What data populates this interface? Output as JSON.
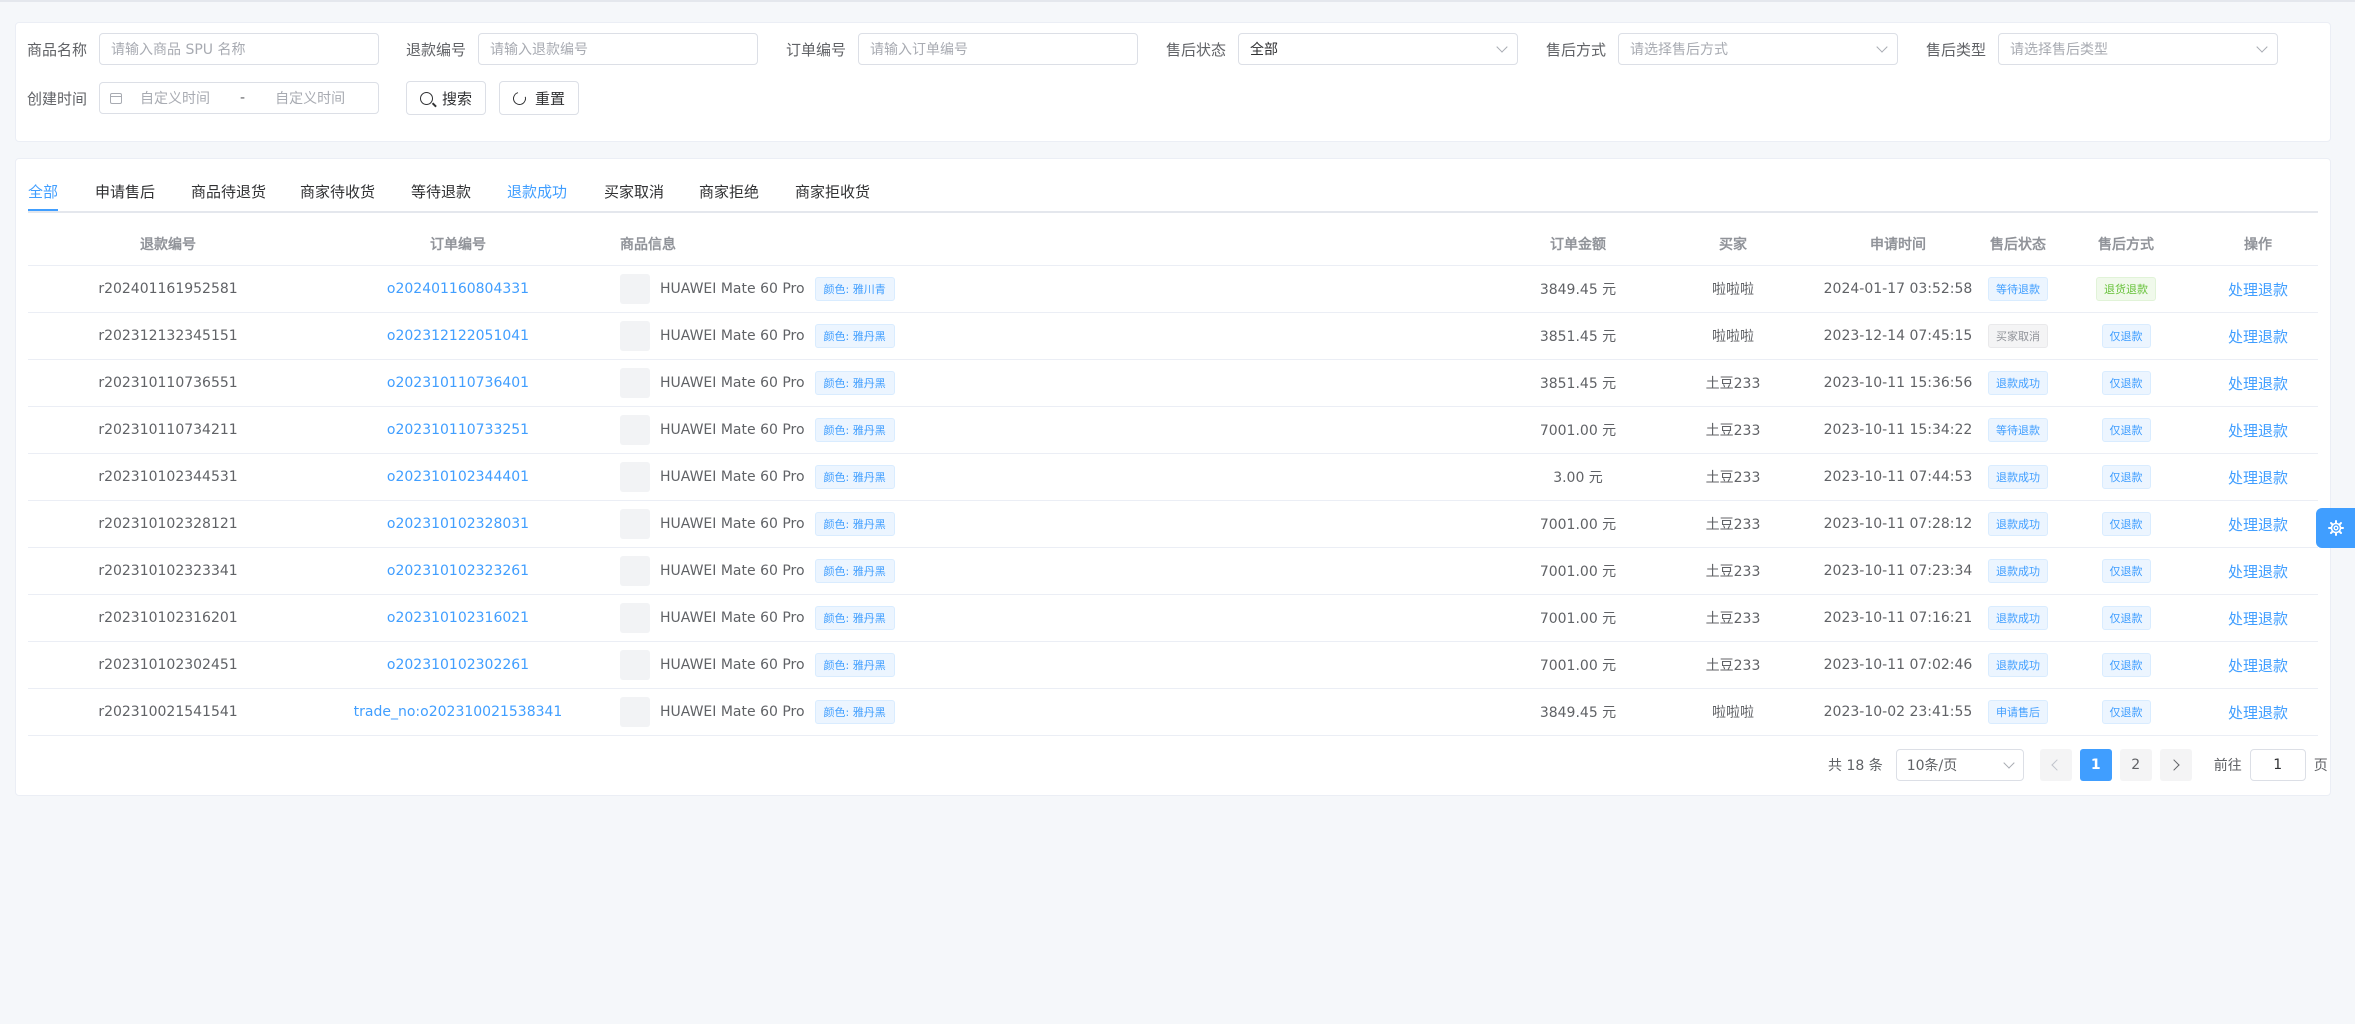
{
  "filters": {
    "product_name": {
      "label": "商品名称",
      "placeholder": "请输入商品 SPU 名称"
    },
    "refund_no": {
      "label": "退款编号",
      "placeholder": "请输入退款编号"
    },
    "order_no": {
      "label": "订单编号",
      "placeholder": "请输入订单编号"
    },
    "aftersale_status": {
      "label": "售后状态",
      "value": "全部"
    },
    "aftersale_way": {
      "label": "售后方式",
      "placeholder": "请选择售后方式"
    },
    "aftersale_type": {
      "label": "售后类型",
      "placeholder": "请选择售后类型"
    },
    "create_time": {
      "label": "创建时间",
      "start_placeholder": "自定义时间",
      "separator": "-",
      "end_placeholder": "自定义时间"
    },
    "search_label": "搜索",
    "reset_label": "重置"
  },
  "tabs": [
    "全部",
    "申请售后",
    "商品待退货",
    "商家待收货",
    "等待退款",
    "退款成功",
    "买家取消",
    "商家拒绝",
    "商家拒收货"
  ],
  "table": {
    "headers": [
      "退款编号",
      "订单编号",
      "商品信息",
      "订单金额",
      "买家",
      "申请时间",
      "售后状态",
      "售后方式",
      "操作"
    ],
    "rows": [
      {
        "refund_no": "r202401161952581",
        "order_no": "o202401160804331",
        "product": "HUAWEI Mate 60 Pro",
        "spec": "颜色: 雅川青",
        "amount": "3849.45 元",
        "buyer": "啦啦啦",
        "time": "2024-01-17 03:52:58",
        "status": "等待退款",
        "way": "退货退款",
        "action": "处理退款"
      },
      {
        "refund_no": "r202312132345151",
        "order_no": "o202312122051041",
        "product": "HUAWEI Mate 60 Pro",
        "spec": "颜色: 雅丹黑",
        "amount": "3851.45 元",
        "buyer": "啦啦啦",
        "time": "2023-12-14 07:45:15",
        "status": "买家取消",
        "way": "仅退款",
        "action": "处理退款"
      },
      {
        "refund_no": "r202310110736551",
        "order_no": "o202310110736401",
        "product": "HUAWEI Mate 60 Pro",
        "spec": "颜色: 雅丹黑",
        "amount": "3851.45 元",
        "buyer": "土豆233",
        "time": "2023-10-11 15:36:56",
        "status": "退款成功",
        "way": "仅退款",
        "action": "处理退款"
      },
      {
        "refund_no": "r202310110734211",
        "order_no": "o202310110733251",
        "product": "HUAWEI Mate 60 Pro",
        "spec": "颜色: 雅丹黑",
        "amount": "7001.00 元",
        "buyer": "土豆233",
        "time": "2023-10-11 15:34:22",
        "status": "等待退款",
        "way": "仅退款",
        "action": "处理退款"
      },
      {
        "refund_no": "r202310102344531",
        "order_no": "o202310102344401",
        "product": "HUAWEI Mate 60 Pro",
        "spec": "颜色: 雅丹黑",
        "amount": "3.00 元",
        "buyer": "土豆233",
        "time": "2023-10-11 07:44:53",
        "status": "退款成功",
        "way": "仅退款",
        "action": "处理退款"
      },
      {
        "refund_no": "r202310102328121",
        "order_no": "o202310102328031",
        "product": "HUAWEI Mate 60 Pro",
        "spec": "颜色: 雅丹黑",
        "amount": "7001.00 元",
        "buyer": "土豆233",
        "time": "2023-10-11 07:28:12",
        "status": "退款成功",
        "way": "仅退款",
        "action": "处理退款"
      },
      {
        "refund_no": "r202310102323341",
        "order_no": "o202310102323261",
        "product": "HUAWEI Mate 60 Pro",
        "spec": "颜色: 雅丹黑",
        "amount": "7001.00 元",
        "buyer": "土豆233",
        "time": "2023-10-11 07:23:34",
        "status": "退款成功",
        "way": "仅退款",
        "action": "处理退款"
      },
      {
        "refund_no": "r202310102316201",
        "order_no": "o202310102316021",
        "product": "HUAWEI Mate 60 Pro",
        "spec": "颜色: 雅丹黑",
        "amount": "7001.00 元",
        "buyer": "土豆233",
        "time": "2023-10-11 07:16:21",
        "status": "退款成功",
        "way": "仅退款",
        "action": "处理退款"
      },
      {
        "refund_no": "r202310102302451",
        "order_no": "o202310102302261",
        "product": "HUAWEI Mate 60 Pro",
        "spec": "颜色: 雅丹黑",
        "amount": "7001.00 元",
        "buyer": "土豆233",
        "time": "2023-10-11 07:02:46",
        "status": "退款成功",
        "way": "仅退款",
        "action": "处理退款"
      },
      {
        "refund_no": "r202310021541541",
        "order_no": "trade_no:o202310021538341",
        "product": "HUAWEI Mate 60 Pro",
        "spec": "颜色: 雅丹黑",
        "amount": "3849.45 元",
        "buyer": "啦啦啦",
        "time": "2023-10-02 23:41:55",
        "status": "申请售后",
        "way": "仅退款",
        "action": "处理退款"
      }
    ]
  },
  "pagination": {
    "total": "共 18 条",
    "page_size": "10条/页",
    "pages": [
      "1",
      "2"
    ],
    "current": "1",
    "goto_prefix": "前往",
    "goto_value": "1",
    "goto_suffix": "页"
  },
  "colors": {
    "accent": "#409eff",
    "success": "#67c23a",
    "muted": "#909399"
  },
  "icons": {
    "settings_tab": "gear-icon"
  }
}
